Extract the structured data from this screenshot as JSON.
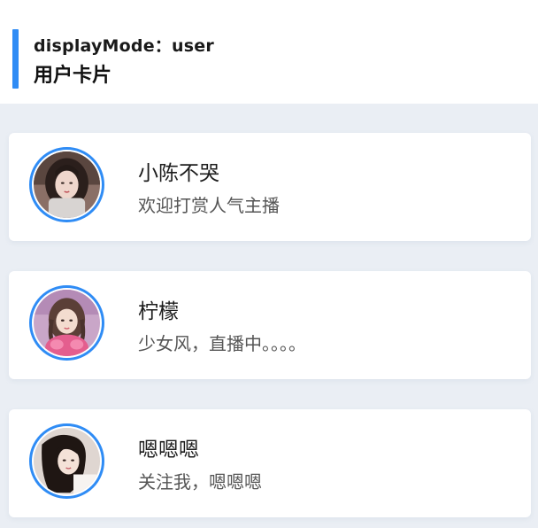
{
  "header": {
    "mode_label": "displayMode：user",
    "title": "用户卡片",
    "accent_color": "#2f8cf5"
  },
  "cards": [
    {
      "name": "小陈不哭",
      "desc": "欢迎打赏人气主播",
      "avatar_icon": "avatar-photo-woman-dark-hair"
    },
    {
      "name": "柠檬",
      "desc": "少女风，直播中。。。。",
      "avatar_icon": "avatar-photo-girl-pink-outfit"
    },
    {
      "name": "嗯嗯嗯",
      "desc": "关注我，嗯嗯嗯",
      "avatar_icon": "avatar-photo-woman-long-hair"
    }
  ]
}
